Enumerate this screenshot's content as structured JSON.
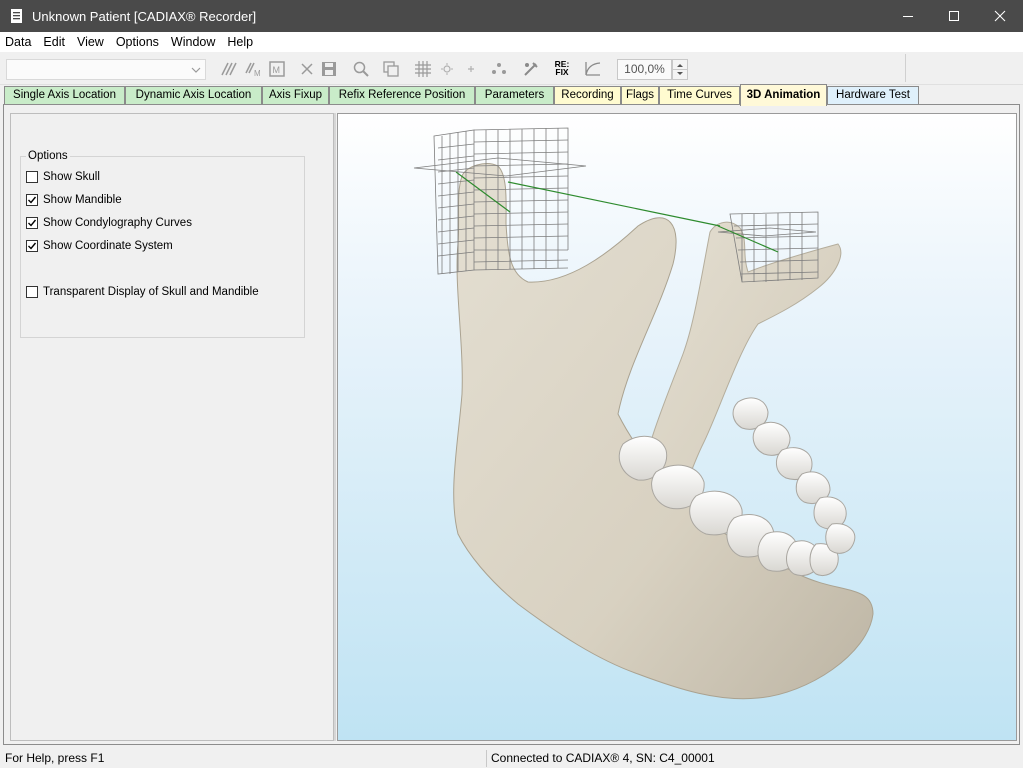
{
  "window": {
    "title": "Unknown Patient [CADIAX® Recorder]"
  },
  "menu": [
    "Data",
    "Edit",
    "View",
    "Options",
    "Window",
    "Help"
  ],
  "toolbar": {
    "zoom_value": "100,0%",
    "refix_label_top": "RE:",
    "refix_label_bottom": "FIX"
  },
  "tabs": [
    {
      "label": "Single Axis Location",
      "active": false
    },
    {
      "label": "Dynamic Axis Location",
      "active": false
    },
    {
      "label": "Axis Fixup",
      "active": false
    },
    {
      "label": "Refix Reference Position",
      "active": false
    },
    {
      "label": "Parameters",
      "active": false
    },
    {
      "label": "Recording",
      "active": false
    },
    {
      "label": "Flags",
      "active": false
    },
    {
      "label": "Time Curves",
      "active": false
    },
    {
      "label": "3D Animation",
      "active": true
    },
    {
      "label": "Hardware Test",
      "active": false
    }
  ],
  "options": {
    "legend": "Options",
    "items": [
      {
        "label": "Show Skull",
        "checked": false
      },
      {
        "label": "Show Mandible",
        "checked": true
      },
      {
        "label": "Show Condylography Curves",
        "checked": true
      },
      {
        "label": "Show Coordinate System",
        "checked": true
      },
      {
        "label": "Transparent Display of Skull and Mandible",
        "checked": false
      }
    ]
  },
  "status": {
    "help": "For Help, press F1",
    "connection": "Connected to CADIAX® 4, SN: C4_00001"
  },
  "colors": {
    "bone": "#dcd6c8",
    "bone_shadow": "#b9b2a2",
    "tooth": "#f4f3f0",
    "curve": "#2e8b2e",
    "grid": "#7d7d7d",
    "titlebar": "#4a4a4a"
  }
}
